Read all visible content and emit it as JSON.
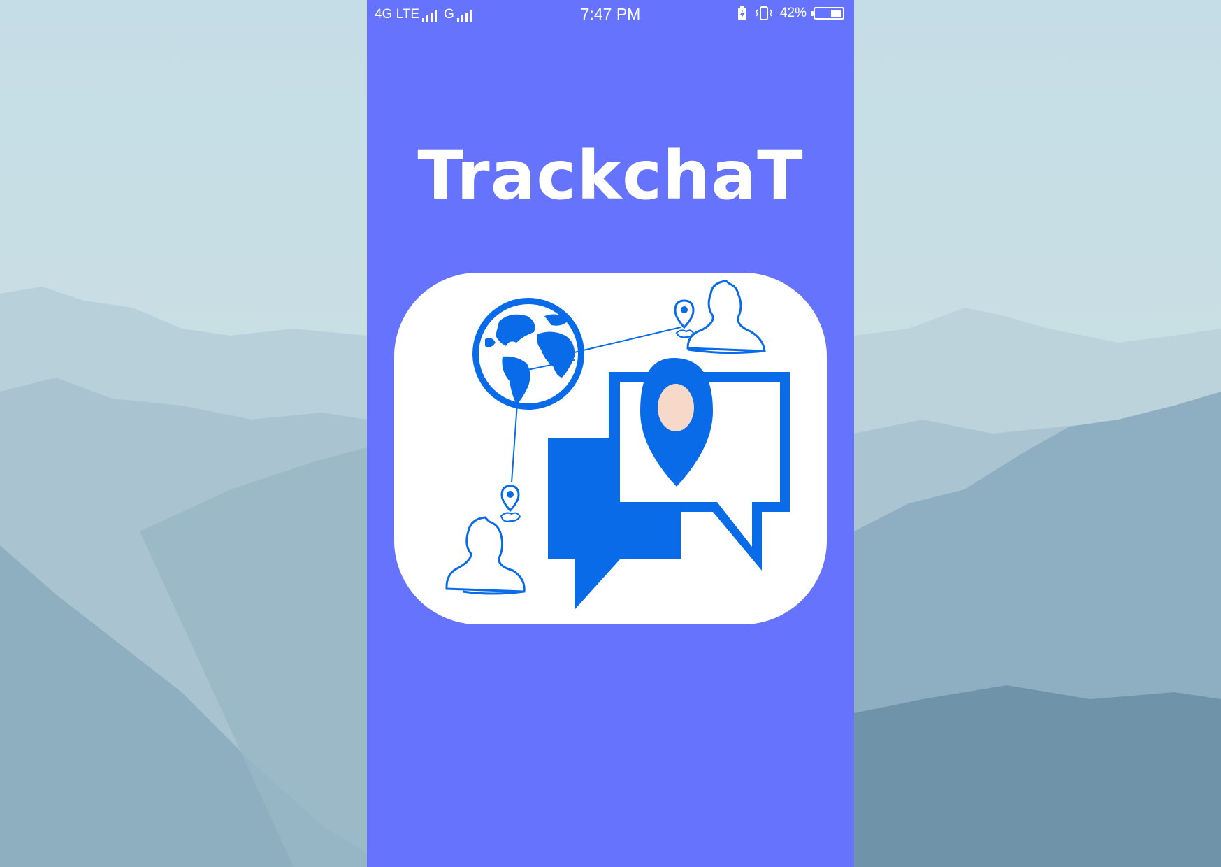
{
  "status_bar": {
    "network_1": "4G LTE",
    "network_2": "G",
    "time": "7:47 PM",
    "battery_text": "42%",
    "battery_level": 0.42
  },
  "app": {
    "title": "TrackchaT"
  },
  "colors": {
    "screen_background": "#6674fd",
    "logo_blue": "#0a6be8",
    "logo_background": "#ffffff",
    "pin_center": "#f6d9c9"
  },
  "icons": {
    "logo": "trackchat-logo",
    "globe": "globe-icon",
    "user_top": "user-outline-icon",
    "user_bottom": "user-outline-icon",
    "chat": "chat-bubbles-icon",
    "pin": "location-pin-icon"
  }
}
